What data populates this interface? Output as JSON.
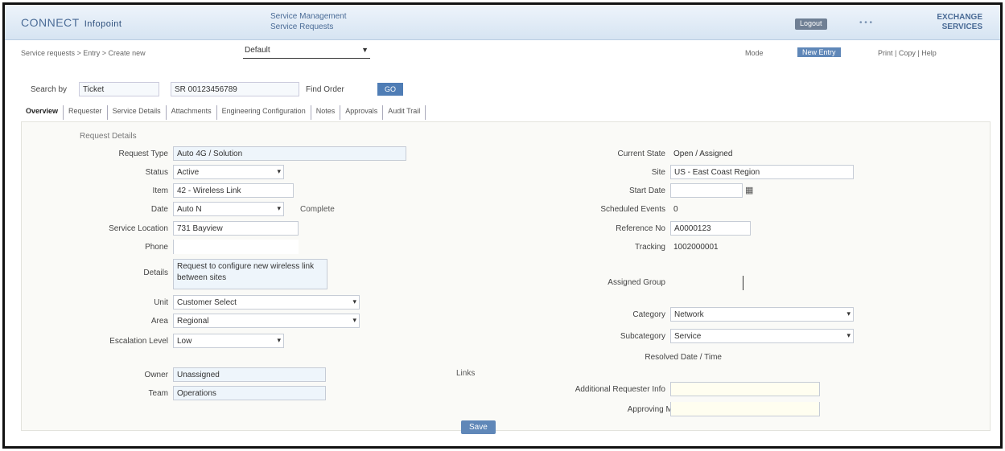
{
  "header": {
    "logo": "CONNECT",
    "logo_sub": "Infopoint",
    "app_title_1": "Service Management",
    "app_title_2": "Service Requests",
    "btn_1": "Logout",
    "dots": "• • •",
    "brand_1": "EXCHANGE",
    "brand_2": "SERVICES"
  },
  "subbar": {
    "breadcrumb": "Service requests > Entry > Create new",
    "select_value": "Default",
    "right_1": "Mode",
    "badge": "New Entry",
    "right_2": "Print | Copy | Help"
  },
  "criteria": {
    "label_1": "Search by",
    "value_1": "Ticket",
    "field_1": "SR 00123456789",
    "label_2": "Find Order",
    "go": "GO"
  },
  "tabs": [
    "Overview",
    "Requester",
    "Service Details",
    "Attachments",
    "Engineering Configuration",
    "Notes",
    "Approvals",
    "Audit Trail"
  ],
  "form": {
    "section_title": "Request Details",
    "left": {
      "request_type_label": "Request Type",
      "request_type_value": "Auto 4G / Solution",
      "status_label": "Status",
      "status_value": "Active",
      "item_label": "Item",
      "item_value": "42 - Wireless Link",
      "date_label": "Date",
      "date_value": "Auto N",
      "date_note": "Complete",
      "contact_label": "Service Location",
      "contact_value": "731 Bayview",
      "phone_label": "Phone",
      "phone_value": "",
      "details_label": "Details",
      "details_value": "Request to configure new wireless link between sites",
      "unit_label": "Unit",
      "unit_value": "Customer Select",
      "area_label": "Area",
      "area_value": "Regional",
      "priority_label": "Escalation Level",
      "priority_value": "Low",
      "owner_label": "Owner",
      "owner_value": "Unassigned",
      "team_label": "Team",
      "team_value": "Operations"
    },
    "right": {
      "current_state_label": "Current State",
      "current_state_value": "Open / Assigned",
      "site_label": "Site",
      "site_value": "US - East Coast Region",
      "start_date_label": "Start Date",
      "start_date_value": "",
      "sla_label": "Scheduled Events",
      "sla_value": "0",
      "ref_label": "Reference No",
      "ref_value": "A0000123",
      "tracking_label": "Tracking",
      "tracking_value": "1002000001",
      "assign_label": "Assigned Group",
      "assign_value": "",
      "category_label": "Category",
      "category_value": "Network",
      "subcat_label": "Subcategory",
      "subcat_value": "Service",
      "resolved_label": "Resolved Date / Time",
      "resolved_value": "",
      "notes_label": "Additional Requester Info",
      "notes_value": "",
      "approver_label": "Approving Manager",
      "approver_value": ""
    },
    "center_label": "Links",
    "submit": "Save"
  }
}
